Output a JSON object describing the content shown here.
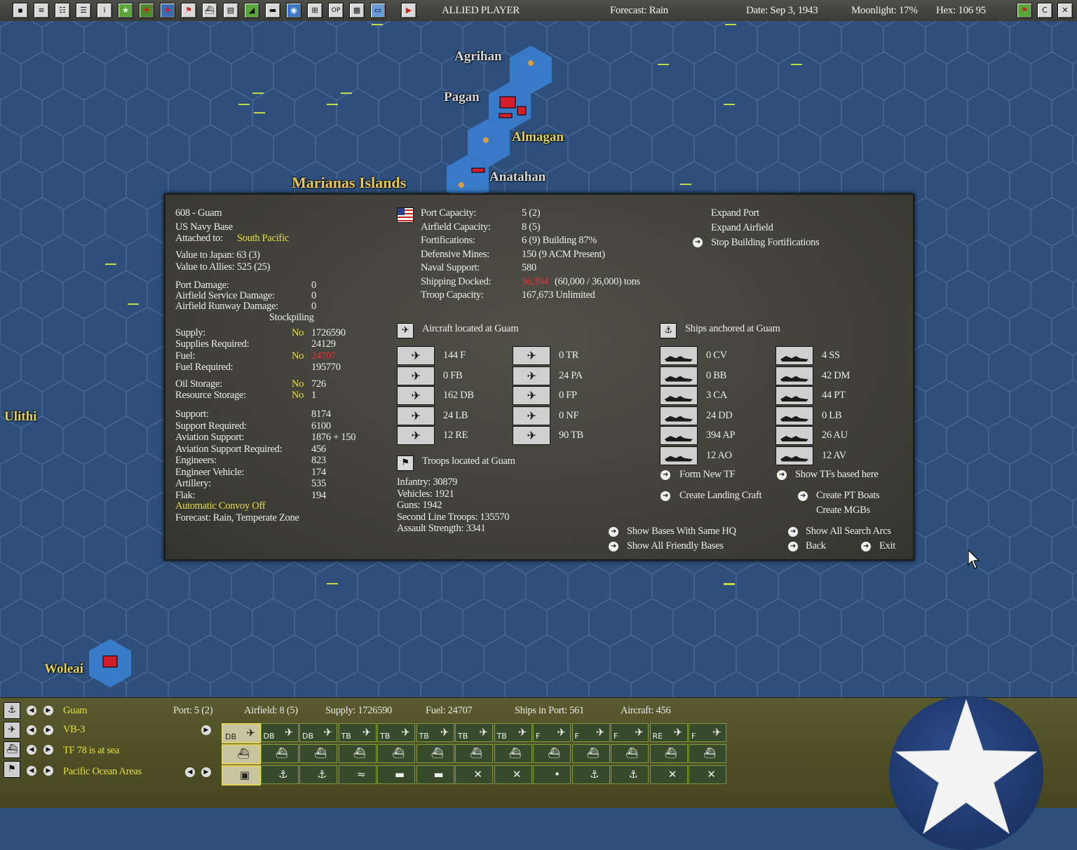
{
  "topbar": {
    "icons": [
      "info-sheet-icon",
      "report-icon",
      "review-icon",
      "list-icon",
      "info-icon",
      "star-icon",
      "aircraft-icon",
      "medical-icon",
      "flag-icon",
      "ship-icon",
      "cargo-icon",
      "chart-icon",
      "convoy-icon",
      "globe-icon",
      "grid-icon",
      "op-icon",
      "table-icon",
      "screen-icon",
      "end-turn-icon"
    ],
    "player": "ALLIED PLAYER",
    "forecast": "Forecast: Rain",
    "date": "Date: Sep 3, 1943",
    "moonlight": "Moonlight: 17%",
    "hex": "Hex: 106 95",
    "right_icons": [
      "flag-icon",
      "c-icon",
      "close-icon"
    ]
  },
  "map": {
    "labels": {
      "agrihan": "Agrihan",
      "pagan": "Pagan",
      "almagan": "Almagan",
      "anatahan": "Anatahan",
      "marianas": "Marianas Islands",
      "ulithi": "Ulithi",
      "woleai": "Woleai"
    }
  },
  "base": {
    "title": "608 - Guam",
    "type": "US Navy Base",
    "attached_label": "Attached to:",
    "attached_value": "South Pacific",
    "value_japan": "Value to Japan: 63 (3)",
    "value_allies": "Value to Allies: 525 (25)",
    "damage": [
      {
        "label": "Port Damage:",
        "value": "0"
      },
      {
        "label": "Airfield Service Damage:",
        "value": "0"
      },
      {
        "label": "Airfield Runway Damage:",
        "value": "0"
      }
    ],
    "stockpiling": "Stockpiling",
    "supply": [
      {
        "label": "Supply:",
        "flag": "No",
        "value": "1726590"
      },
      {
        "label": "Supplies Required:",
        "flag": "",
        "value": "24129"
      },
      {
        "label": "Fuel:",
        "flag": "No",
        "value": "24707",
        "red": true
      },
      {
        "label": "Fuel Required:",
        "flag": "",
        "value": "195770"
      }
    ],
    "storage": [
      {
        "label": "Oil Storage:",
        "flag": "No",
        "value": "726"
      },
      {
        "label": "Resource Storage:",
        "flag": "No",
        "value": "1"
      }
    ],
    "support": [
      {
        "label": "Support:",
        "value": "8174"
      },
      {
        "label": "Support Required:",
        "value": "6100"
      },
      {
        "label": "Aviation Support:",
        "value": "1876 + 150"
      },
      {
        "label": "Aviation Support Required:",
        "value": "456"
      },
      {
        "label": "Engineers:",
        "value": "823"
      },
      {
        "label": "Engineer Vehicle:",
        "value": "174"
      },
      {
        "label": "Artillery:",
        "value": "535"
      },
      {
        "label": "Flak:",
        "value": "194"
      }
    ],
    "convoy": "Automatic Convoy Off",
    "forecast": "Forecast: Rain, Temperate Zone",
    "capacity": [
      {
        "label": "Port Capacity:",
        "value": "5 (2)"
      },
      {
        "label": "Airfield Capacity:",
        "value": "8 (5)"
      },
      {
        "label": "Fortifications:",
        "value": "6 (9) Building 87%"
      },
      {
        "label": "Defensive Mines:",
        "value": "150 (9 ACM Present)"
      },
      {
        "label": "Naval Support:",
        "value": "580"
      },
      {
        "label": "Shipping Docked:",
        "value_red": "56,394",
        "value": "(60,000 / 36,000) tons"
      },
      {
        "label": "Troop Capacity:",
        "value": "167,673    Unlimited"
      }
    ],
    "actions_top": [
      "Expand Port",
      "Expand Airfield",
      "Stop Building Fortifications"
    ],
    "aircraft_header": "Aircraft located at Guam",
    "aircraft_left": [
      "144 F",
      "0 FB",
      "162 DB",
      "24 LB",
      "12 RE"
    ],
    "aircraft_right": [
      "0 TR",
      "24 PA",
      "0 FP",
      "0 NF",
      "90 TB"
    ],
    "ships_header": "Ships anchored at Guam",
    "ships_left": [
      "0 CV",
      "0 BB",
      "3 CA",
      "24 DD",
      "394 AP",
      "12 AO"
    ],
    "ships_right": [
      "4 SS",
      "42 DM",
      "44 PT",
      "0 LB",
      "26 AU",
      "12 AV"
    ],
    "troops_header": "Troops located at Guam",
    "troops": [
      "Infantry: 30879",
      "Vehicles: 1921",
      "Guns: 1942",
      "Second Line Troops: 135570",
      "Assault Strength: 3341"
    ],
    "buttons": {
      "form_tf": "Form New TF",
      "show_tfs": "Show TFs based here",
      "landing_craft": "Create Landing Craft",
      "pt_boats": "Create PT Boats",
      "mgbs": "Create MGBs",
      "same_hq": "Show Bases With Same HQ",
      "search_arcs": "Show All Search Arcs",
      "friendly": "Show All Friendly Bases",
      "back": "Back",
      "exit": "Exit"
    }
  },
  "bottom": {
    "rows": [
      "Guam",
      "VB-3",
      "TF 78 is at sea",
      "Pacific Ocean Areas"
    ],
    "stats": {
      "port": "Port: 5 (2)",
      "airfield": "Airfield: 8 (5)",
      "supply": "Supply: 1726590",
      "fuel": "Fuel: 24707",
      "ships": "Ships in Port: 561",
      "aircraft": "Aircraft: 456"
    },
    "air_slots": [
      "DB",
      "DB",
      "DB",
      "TB",
      "TB",
      "TB",
      "TB",
      "TB",
      "F",
      "F",
      "F",
      "RE",
      "F"
    ]
  }
}
